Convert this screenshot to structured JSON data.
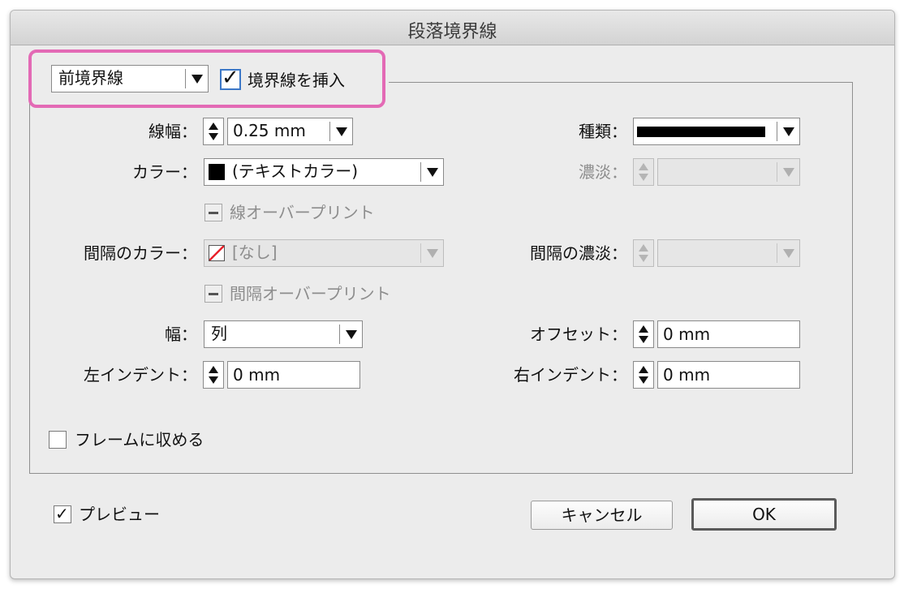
{
  "dialog": {
    "title": "段落境界線",
    "rule_position": "前境界線",
    "insert_rule": {
      "label": "境界線を挿入",
      "checked": true
    },
    "weight": {
      "label": "線幅：",
      "value": "0.25 mm"
    },
    "type": {
      "label": "種類：",
      "value": "solid-line"
    },
    "color": {
      "label": "カラー：",
      "value": "(テキストカラー)",
      "swatch": "#000000"
    },
    "tint": {
      "label": "濃淡：",
      "value": ""
    },
    "overprint_stroke": {
      "label": "線オーバープリント",
      "state": "mixed"
    },
    "gap_color": {
      "label": "間隔のカラー：",
      "value": "[なし]"
    },
    "gap_tint": {
      "label": "間隔の濃淡：",
      "value": ""
    },
    "overprint_gap": {
      "label": "間隔オーバープリント",
      "state": "mixed"
    },
    "width": {
      "label": "幅：",
      "value": "列"
    },
    "offset": {
      "label": "オフセット：",
      "value": "0 mm"
    },
    "left_indent": {
      "label": "左インデント：",
      "value": "0 mm"
    },
    "right_indent": {
      "label": "右インデント：",
      "value": "0 mm"
    },
    "keep_in_frame": {
      "label": "フレームに収める",
      "checked": false
    },
    "preview": {
      "label": "プレビュー",
      "checked": true
    },
    "cancel_label": "キャンセル",
    "ok_label": "OK"
  },
  "colors": {
    "highlight": "#e36ab5",
    "none_swatch_slash": "#e8202a"
  }
}
